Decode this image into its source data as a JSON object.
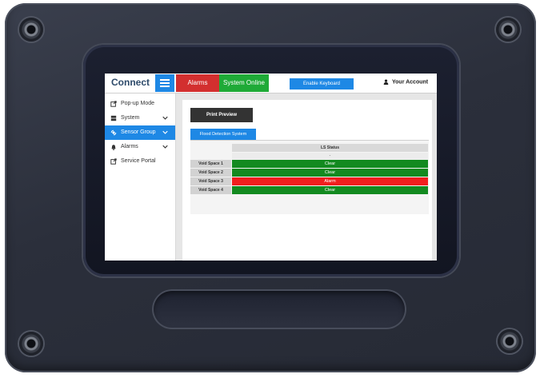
{
  "app": {
    "brand": "Connect"
  },
  "topbar": {
    "alarms_label": "Alarms",
    "status_label": "System Online",
    "keyboard_label": "Enable Keyboard",
    "account_label": "Your Account"
  },
  "sidebar": {
    "items": [
      {
        "label": "Pop-up Mode",
        "icon": "external-link-icon"
      },
      {
        "label": "System",
        "icon": "server-icon"
      },
      {
        "label": "Sensor Group",
        "icon": "sensor-icon",
        "active": true
      },
      {
        "label": "Alarms",
        "icon": "bell-icon"
      },
      {
        "label": "Service Portal",
        "icon": "external-link-icon"
      }
    ]
  },
  "main": {
    "print_label": "Print Preview",
    "tab_label": "Flood Detection System",
    "table": {
      "column_header": "LS Status",
      "column_subheader": "-",
      "rows": [
        {
          "label": "Void Space 1",
          "value": "Clear",
          "status": "clear"
        },
        {
          "label": "Void Space 2",
          "value": "Clear",
          "status": "clear"
        },
        {
          "label": "Void Space 3",
          "value": "Alarm",
          "status": "alarm"
        },
        {
          "label": "Void Space 4",
          "value": "Clear",
          "status": "clear"
        }
      ]
    }
  },
  "colors": {
    "accent": "#1e88e5",
    "alarm": "#d32f2f",
    "online": "#1faa37",
    "clear": "#138a20",
    "alarm_row": "#f01e1e"
  }
}
